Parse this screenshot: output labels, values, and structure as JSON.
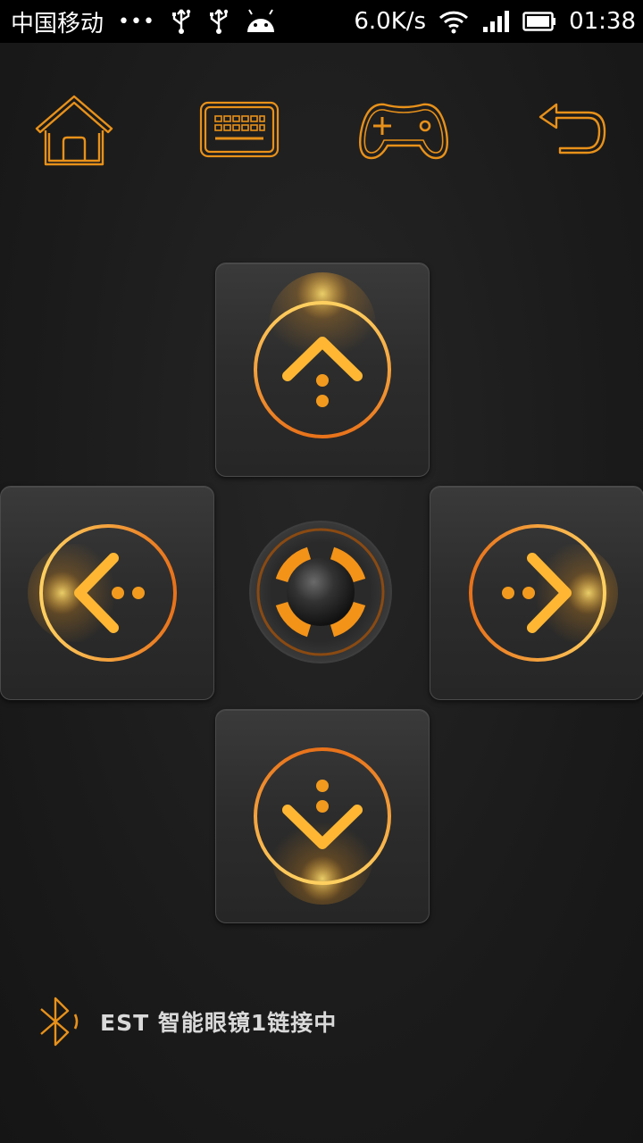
{
  "status_bar": {
    "carrier": "中国移动",
    "dots": "•••",
    "net_speed": "6.0K/s",
    "time": "01:38"
  },
  "toolbar": {
    "items": [
      {
        "name": "home",
        "icon": "home-icon"
      },
      {
        "name": "keyboard",
        "icon": "keyboard-icon"
      },
      {
        "name": "gamepad",
        "icon": "gamepad-icon"
      },
      {
        "name": "back",
        "icon": "back-arrow-icon"
      }
    ]
  },
  "dpad": {
    "buttons": [
      "up",
      "left",
      "right",
      "down",
      "center"
    ]
  },
  "bluetooth": {
    "icon": "bluetooth-icon",
    "status_text": "EST 智能眼镜1链接中"
  },
  "colors": {
    "accent": "#f59a1a",
    "accent_light": "#ffd060",
    "background": "#1c1c1c"
  }
}
